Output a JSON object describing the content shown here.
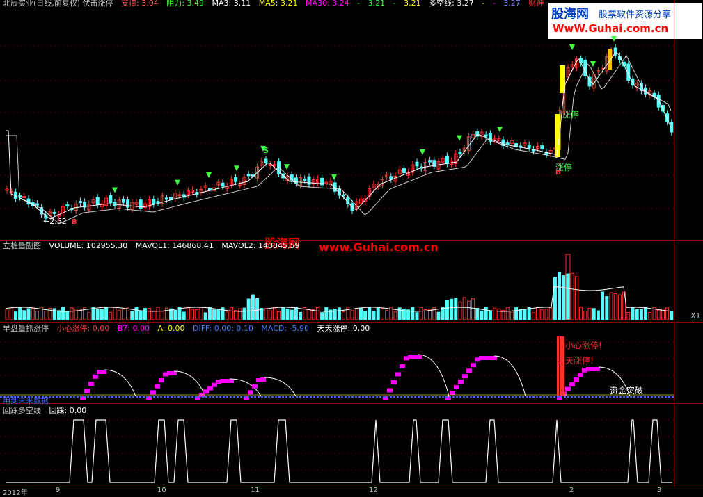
{
  "main": {
    "title": "北辰实业(日线,前复权) 伏击涨停",
    "support_label": "支撑:",
    "support_value": "3.04",
    "resist_label": "阻力:",
    "resist_value": "3.49",
    "ma3": "MA3: 3.11",
    "ma5": "MA5: 3.21",
    "ma30": "MA30: 3.24",
    "dash1": "-",
    "v1": "3.21",
    "dash2": "-",
    "v2": "3.21",
    "duokong": "多空线: 3.27",
    "dash3": "-",
    "dash4": "-",
    "v3": "3.27",
    "caishen": "财神",
    "low_label": "2.52",
    "limit_up_1": "涨停",
    "limit_up_2": "涨停",
    "letter_b": "B",
    "letter_s": "S"
  },
  "volume": {
    "title": "立桩量副图",
    "volume": "VOLUME: 102955.30",
    "mavol1": "MAVOL1: 146868.41",
    "mavol2": "MAVOL2: 140845.59",
    "x1": "X1"
  },
  "panel3": {
    "title": "早盘量抓涨停",
    "xiaoxin": "小心涨停: 0.00",
    "b7": "B7: 0.00",
    "a": "A: 0.00",
    "diff": "DIFF: 0.00",
    "dea": ": 0.10",
    "macd": "MACD: -5.90",
    "tiantian": "天天涨停: 0.00",
    "note1": "小心涨停!",
    "note2": "天天涨停!",
    "note3": "资金突破",
    "bottom_text": "用到未来数据"
  },
  "panel4": {
    "title": "回踩多空线",
    "value": "回踩: 0.00"
  },
  "xaxis": {
    "labels": [
      "2012年",
      "9",
      "10",
      "11",
      "12",
      "2",
      "3"
    ]
  },
  "watermark": {
    "brand": "股海网",
    "slogan": "股票软件资源分享",
    "url": "www.Guhai.com.cn",
    "url_top": "WwW.Guhai.com.cn"
  },
  "colors": {
    "up": "#ff3232",
    "down": "#54ffff",
    "ma": "#ffffff",
    "limit": "#ffff00",
    "macd": "#ff00ff",
    "bg": "#000000",
    "grid": "#8b0000"
  }
}
